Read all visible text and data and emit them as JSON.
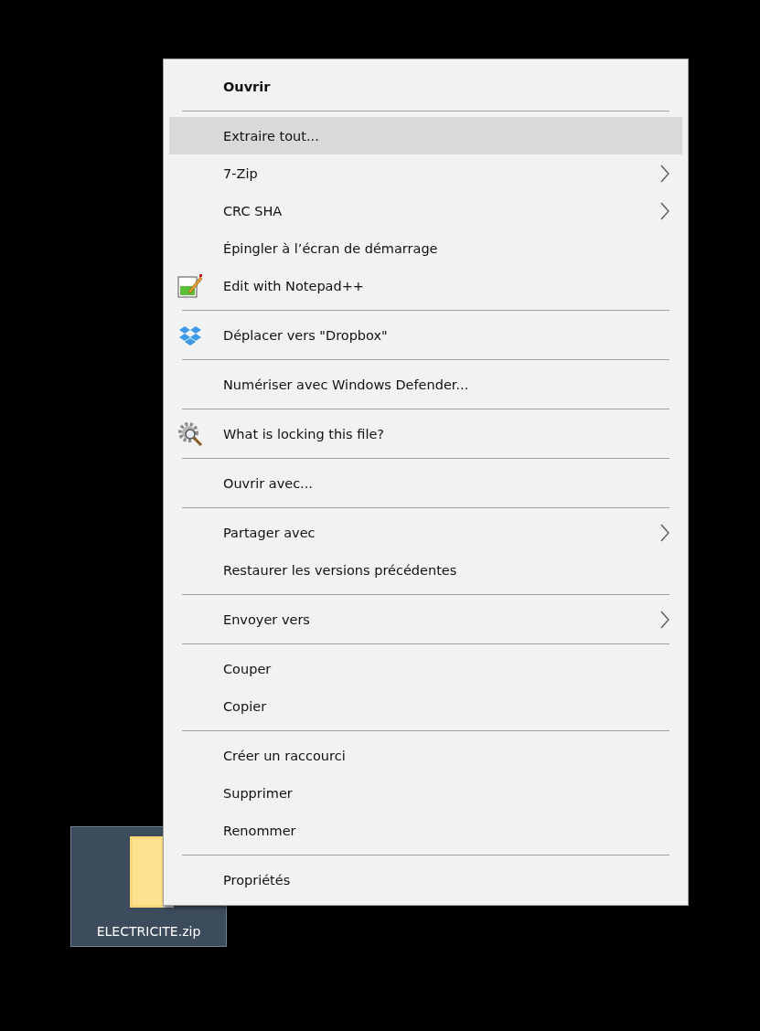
{
  "desktop_icon": {
    "label": "ELECTRICITE.zip",
    "selected": true
  },
  "context_menu": {
    "groups": [
      {
        "items": [
          {
            "label": "Ouvrir",
            "kind": "plain",
            "default": true,
            "submenu": false,
            "selected": false
          }
        ]
      },
      {
        "items": [
          {
            "label": "Extraire tout...",
            "kind": "plain",
            "default": false,
            "submenu": false,
            "selected": true
          },
          {
            "label": "7-Zip",
            "kind": "plain",
            "default": false,
            "submenu": true,
            "selected": false
          },
          {
            "label": "CRC SHA",
            "kind": "plain",
            "default": false,
            "submenu": true,
            "selected": false
          },
          {
            "label": "Épingler à l’écran de démarrage",
            "kind": "plain",
            "default": false,
            "submenu": false,
            "selected": false
          },
          {
            "label": "Edit with Notepad++",
            "kind": "notepad",
            "default": false,
            "submenu": false,
            "selected": false
          }
        ]
      },
      {
        "items": [
          {
            "label": "Déplacer vers \"Dropbox\"",
            "kind": "dropbox",
            "default": false,
            "submenu": false,
            "selected": false
          }
        ]
      },
      {
        "items": [
          {
            "label": "Numériser avec Windows Defender...",
            "kind": "plain",
            "default": false,
            "submenu": false,
            "selected": false
          }
        ]
      },
      {
        "items": [
          {
            "label": "What is locking this file?",
            "kind": "gear",
            "default": false,
            "submenu": false,
            "selected": false
          }
        ]
      },
      {
        "items": [
          {
            "label": "Ouvrir avec...",
            "kind": "plain",
            "default": false,
            "submenu": false,
            "selected": false
          }
        ]
      },
      {
        "items": [
          {
            "label": "Partager avec",
            "kind": "plain",
            "default": false,
            "submenu": true,
            "selected": false
          },
          {
            "label": "Restaurer les versions précédentes",
            "kind": "plain",
            "default": false,
            "submenu": false,
            "selected": false
          }
        ]
      },
      {
        "items": [
          {
            "label": "Envoyer vers",
            "kind": "plain",
            "default": false,
            "submenu": true,
            "selected": false
          }
        ]
      },
      {
        "items": [
          {
            "label": "Couper",
            "kind": "plain",
            "default": false,
            "submenu": false,
            "selected": false
          },
          {
            "label": "Copier",
            "kind": "plain",
            "default": false,
            "submenu": false,
            "selected": false
          }
        ]
      },
      {
        "items": [
          {
            "label": "Créer un raccourci",
            "kind": "plain",
            "default": false,
            "submenu": false,
            "selected": false
          },
          {
            "label": "Supprimer",
            "kind": "plain",
            "default": false,
            "submenu": false,
            "selected": false
          },
          {
            "label": "Renommer",
            "kind": "plain",
            "default": false,
            "submenu": false,
            "selected": false
          }
        ]
      },
      {
        "items": [
          {
            "label": "Propriétés",
            "kind": "plain",
            "default": false,
            "submenu": false,
            "selected": false
          }
        ]
      }
    ]
  }
}
